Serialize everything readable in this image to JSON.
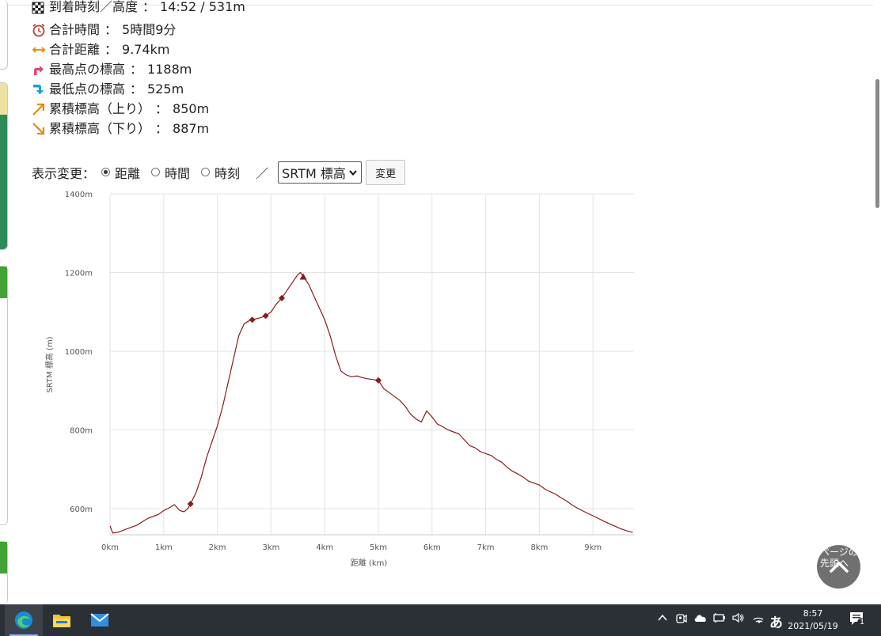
{
  "stats": [
    {
      "icon": "checkered-flag-icon",
      "label": "到着時刻／高度",
      "value": "14:52 / 531m"
    },
    {
      "icon": "alarm-clock-icon",
      "label": "合計時間",
      "value": "5時間9分"
    },
    {
      "icon": "horizontal-arrows-icon",
      "label": "合計距離",
      "value": "9.74km"
    },
    {
      "icon": "up-arrow-icon",
      "label": "最高点の標高",
      "value": "1188m"
    },
    {
      "icon": "down-arrow-icon",
      "label": "最低点の標高",
      "value": "525m"
    },
    {
      "icon": "ascent-arrow-icon",
      "label": "累積標高（上り）",
      "value": "850m"
    },
    {
      "icon": "descent-arrow-icon",
      "label": "累積標高（下り）",
      "value": "887m"
    }
  ],
  "stat_separator": "：",
  "controls": {
    "label": "表示変更：",
    "options": [
      {
        "label": "距離",
        "checked": true
      },
      {
        "label": "時間",
        "checked": false
      },
      {
        "label": "時刻",
        "checked": false
      }
    ],
    "slash": "／",
    "select_value": "SRTM 標高",
    "apply_label": "変更"
  },
  "chart_data": {
    "type": "line",
    "xlabel": "距離 (km)",
    "ylabel": "SRTM 標高 (m)",
    "xlim": [
      0,
      9.74
    ],
    "ylim": [
      535,
      1400
    ],
    "x_ticks": [
      0,
      1,
      2,
      3,
      4,
      5,
      6,
      7,
      8,
      9
    ],
    "x_tick_labels": [
      "0km",
      "1km",
      "2km",
      "3km",
      "4km",
      "5km",
      "6km",
      "7km",
      "8km",
      "9km"
    ],
    "y_ticks": [
      600,
      800,
      1000,
      1200,
      1400
    ],
    "y_tick_labels": [
      "600m",
      "800m",
      "1000m",
      "1200m",
      "1400m"
    ],
    "grid": true,
    "line_color": "#8b1a1a",
    "series": [
      {
        "x": [
          0.0,
          0.05,
          0.15,
          0.3,
          0.5,
          0.7,
          0.9,
          1.0,
          1.1,
          1.2,
          1.3,
          1.38,
          1.45,
          1.5,
          1.6,
          1.7,
          1.8,
          1.9,
          2.0,
          2.1,
          2.2,
          2.3,
          2.4,
          2.5,
          2.6,
          2.65,
          2.8,
          2.9,
          3.0,
          3.1,
          3.2,
          3.3,
          3.4,
          3.5,
          3.55,
          3.6,
          3.7,
          3.8,
          3.9,
          4.0,
          4.1,
          4.2,
          4.3,
          4.4,
          4.5,
          4.6,
          4.7,
          4.8,
          4.9,
          5.0,
          5.1,
          5.2,
          5.3,
          5.4,
          5.5,
          5.6,
          5.7,
          5.8,
          5.9,
          6.0,
          6.1,
          6.2,
          6.3,
          6.4,
          6.5,
          6.6,
          6.7,
          6.8,
          6.9,
          7.0,
          7.1,
          7.2,
          7.3,
          7.4,
          7.5,
          7.6,
          7.7,
          7.8,
          7.9,
          8.0,
          8.1,
          8.2,
          8.3,
          8.4,
          8.5,
          8.6,
          8.7,
          8.8,
          8.9,
          9.0,
          9.1,
          9.2,
          9.3,
          9.4,
          9.5,
          9.6,
          9.7,
          9.74
        ],
        "y": [
          556,
          538,
          540,
          548,
          558,
          575,
          585,
          595,
          602,
          610,
          595,
          592,
          600,
          612,
          640,
          680,
          730,
          770,
          810,
          860,
          920,
          980,
          1040,
          1070,
          1078,
          1080,
          1085,
          1090,
          1100,
          1120,
          1135,
          1155,
          1175,
          1195,
          1200,
          1190,
          1170,
          1140,
          1110,
          1080,
          1040,
          990,
          950,
          940,
          935,
          937,
          933,
          930,
          928,
          926,
          905,
          895,
          885,
          875,
          860,
          840,
          828,
          820,
          848,
          833,
          815,
          808,
          800,
          795,
          790,
          775,
          760,
          755,
          745,
          740,
          735,
          725,
          718,
          705,
          695,
          688,
          680,
          670,
          665,
          660,
          650,
          643,
          637,
          628,
          620,
          610,
          602,
          595,
          588,
          582,
          575,
          568,
          562,
          556,
          550,
          545,
          541,
          540
        ]
      }
    ],
    "waypoints": [
      {
        "x": 1.5,
        "y": 612,
        "shape": "diamond"
      },
      {
        "x": 2.65,
        "y": 1080,
        "shape": "diamond"
      },
      {
        "x": 2.9,
        "y": 1090,
        "shape": "diamond"
      },
      {
        "x": 3.2,
        "y": 1135,
        "shape": "diamond"
      },
      {
        "x": 3.6,
        "y": 1188,
        "shape": "triangle"
      },
      {
        "x": 5.0,
        "y": 926,
        "shape": "diamond"
      }
    ]
  },
  "back_to_top": {
    "label": "ページの先頭へ"
  },
  "taskbar": {
    "apps": [
      "edge-icon",
      "file-explorer-icon",
      "mail-icon"
    ],
    "ime_label": "あ",
    "time": "8:57",
    "date": "2021/05/19",
    "notification_count": "1"
  }
}
